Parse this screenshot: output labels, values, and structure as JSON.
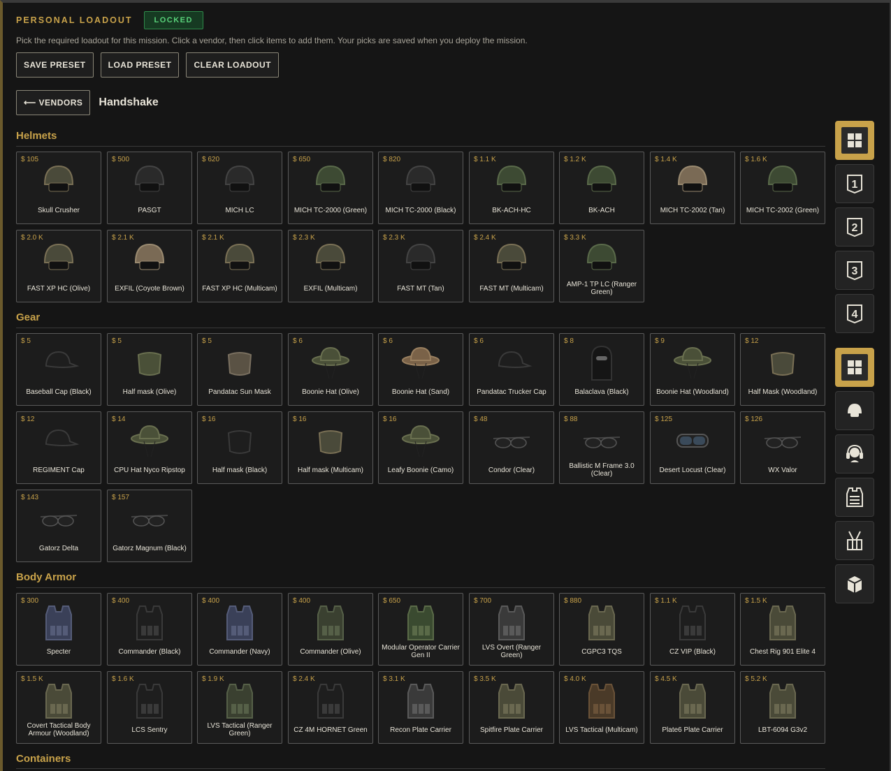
{
  "header": {
    "title": "PERSONAL LOADOUT",
    "status_badge": "LOCKED"
  },
  "description": "Pick the required loadout for this mission. Click a vendor, then click items to add them. Your picks are saved when you deploy the mission.",
  "actions": {
    "save_preset": "SAVE PRESET",
    "load_preset": "LOAD PRESET",
    "clear_loadout": "CLEAR LOADOUT"
  },
  "vendor_nav": {
    "back_label": "⟵ VENDORS",
    "vendor_name": "Handshake"
  },
  "sections": [
    {
      "title": "Helmets",
      "items": [
        {
          "price": "$ 105",
          "name": "Skull Crusher",
          "kind": "helmet-camo"
        },
        {
          "price": "$ 500",
          "name": "PASGT",
          "kind": "helmet-black"
        },
        {
          "price": "$ 620",
          "name": "MICH LC",
          "kind": "helmet-black"
        },
        {
          "price": "$ 650",
          "name": "MICH TC-2000 (Green)",
          "kind": "helmet-green"
        },
        {
          "price": "$ 820",
          "name": "MICH TC-2000 (Black)",
          "kind": "helmet-black"
        },
        {
          "price": "$ 1.1 K",
          "name": "BK-ACH-HC",
          "kind": "helmet-green"
        },
        {
          "price": "$ 1.2 K",
          "name": "BK-ACH",
          "kind": "helmet-green"
        },
        {
          "price": "$ 1.4 K",
          "name": "MICH TC-2002 (Tan)",
          "kind": "helmet-tan"
        },
        {
          "price": "$ 1.6 K",
          "name": "MICH TC-2002 (Green)",
          "kind": "helmet-green"
        },
        {
          "price": "$ 2.0 K",
          "name": "FAST XP HC (Olive)",
          "kind": "helmet-camo"
        },
        {
          "price": "$ 2.1 K",
          "name": "EXFIL (Coyote Brown)",
          "kind": "helmet-tan"
        },
        {
          "price": "$ 2.1 K",
          "name": "FAST XP HC (Multicam)",
          "kind": "helmet-camo"
        },
        {
          "price": "$ 2.3 K",
          "name": "EXFIL (Multicam)",
          "kind": "helmet-camo"
        },
        {
          "price": "$ 2.3 K",
          "name": "FAST MT (Tan)",
          "kind": "helmet-black"
        },
        {
          "price": "$ 2.4 K",
          "name": "FAST MT (Multicam)",
          "kind": "helmet-camo"
        },
        {
          "price": "$ 3.3 K",
          "name": "AMP-1 TP LC (Ranger Green)",
          "kind": "helmet-green"
        }
      ]
    },
    {
      "title": "Gear",
      "items": [
        {
          "price": "$ 5",
          "name": "Baseball Cap (Black)",
          "kind": "cap-black"
        },
        {
          "price": "$ 5",
          "name": "Half mask (Olive)",
          "kind": "mask-olive"
        },
        {
          "price": "$ 5",
          "name": "Pandatac Sun Mask",
          "kind": "mask-tan"
        },
        {
          "price": "$ 6",
          "name": "Boonie Hat (Olive)",
          "kind": "boonie-olive"
        },
        {
          "price": "$ 6",
          "name": "Boonie Hat (Sand)",
          "kind": "boonie-sand"
        },
        {
          "price": "$ 6",
          "name": "Pandatac Trucker Cap",
          "kind": "cap-black"
        },
        {
          "price": "$ 8",
          "name": "Balaclava (Black)",
          "kind": "balaclava"
        },
        {
          "price": "$ 9",
          "name": "Boonie Hat (Woodland)",
          "kind": "boonie-olive"
        },
        {
          "price": "$ 12",
          "name": "Half Mask (Woodland)",
          "kind": "mask-camo"
        },
        {
          "price": "$ 12",
          "name": "REGIMENT Cap",
          "kind": "cap-black"
        },
        {
          "price": "$ 14",
          "name": "CPU Hat Nyco Ripstop",
          "kind": "boonie-olive"
        },
        {
          "price": "$ 16",
          "name": "Half mask (Black)",
          "kind": "mask-black"
        },
        {
          "price": "$ 16",
          "name": "Half mask (Multicam)",
          "kind": "mask-camo"
        },
        {
          "price": "$ 16",
          "name": "Leafy Boonie (Camo)",
          "kind": "boonie-olive"
        },
        {
          "price": "$ 48",
          "name": "Condor (Clear)",
          "kind": "glasses"
        },
        {
          "price": "$ 88",
          "name": "Ballistic M Frame 3.0 (Clear)",
          "kind": "glasses"
        },
        {
          "price": "$ 125",
          "name": "Desert Locust (Clear)",
          "kind": "goggles"
        },
        {
          "price": "$ 126",
          "name": "WX Valor",
          "kind": "glasses"
        },
        {
          "price": "$ 143",
          "name": "Gatorz Delta",
          "kind": "glasses"
        },
        {
          "price": "$ 157",
          "name": "Gatorz Magnum (Black)",
          "kind": "glasses-wide"
        }
      ]
    },
    {
      "title": "Body Armor",
      "items": [
        {
          "price": "$ 300",
          "name": "Specter",
          "kind": "vest-navy"
        },
        {
          "price": "$ 400",
          "name": "Commander (Black)",
          "kind": "vest-black"
        },
        {
          "price": "$ 400",
          "name": "Commander (Navy)",
          "kind": "vest-navy"
        },
        {
          "price": "$ 400",
          "name": "Commander (Olive)",
          "kind": "vest-olive"
        },
        {
          "price": "$ 650",
          "name": "Modular Operator Carrier Gen II",
          "kind": "vest-green"
        },
        {
          "price": "$ 700",
          "name": "LVS Overt (Ranger Green)",
          "kind": "vest-grey"
        },
        {
          "price": "$ 880",
          "name": "CGPC3 TQS",
          "kind": "vest-camo"
        },
        {
          "price": "$ 1.1 K",
          "name": "CZ VIP (Black)",
          "kind": "vest-black"
        },
        {
          "price": "$ 1.5 K",
          "name": "Chest Rig 901 Elite 4",
          "kind": "vest-camo"
        },
        {
          "price": "$ 1.5 K",
          "name": "Covert Tactical Body Armour (Woodland)",
          "kind": "vest-camo"
        },
        {
          "price": "$ 1.6 K",
          "name": "LCS Sentry",
          "kind": "vest-black"
        },
        {
          "price": "$ 1.9 K",
          "name": "LVS Tactical (Ranger Green)",
          "kind": "vest-olive"
        },
        {
          "price": "$ 2.4 K",
          "name": "CZ 4M HORNET Green",
          "kind": "vest-black"
        },
        {
          "price": "$ 3.1 K",
          "name": "Recon Plate Carrier",
          "kind": "vest-grey"
        },
        {
          "price": "$ 3.5 K",
          "name": "Spitfire Plate Carrier",
          "kind": "vest-camo"
        },
        {
          "price": "$ 4.0 K",
          "name": "LVS Tactical (Multicam)",
          "kind": "vest-brown"
        },
        {
          "price": "$ 4.5 K",
          "name": "Plate6 Plate Carrier",
          "kind": "vest-camo"
        },
        {
          "price": "$ 5.2 K",
          "name": "LBT-6094 G3v2",
          "kind": "vest-camo"
        }
      ]
    },
    {
      "title": "Containers",
      "items": []
    }
  ],
  "sidebar": {
    "group_a": [
      {
        "icon": "grid-icon",
        "active": true
      },
      {
        "icon": "slot-1-icon",
        "label": "1"
      },
      {
        "icon": "slot-2-icon",
        "label": "2"
      },
      {
        "icon": "slot-3-icon",
        "label": "3"
      },
      {
        "icon": "slot-4-icon",
        "label": "4"
      }
    ],
    "group_b": [
      {
        "icon": "grid-icon",
        "active": true
      },
      {
        "icon": "helmet-icon"
      },
      {
        "icon": "headset-icon"
      },
      {
        "icon": "body-armor-icon"
      },
      {
        "icon": "chest-rig-icon"
      },
      {
        "icon": "container-box-icon"
      }
    ]
  },
  "colors": {
    "accent": "#c8a24a",
    "locked_text": "#59d27a",
    "locked_bg": "#163a22",
    "background": "#151515",
    "card": "#1c1c1c"
  }
}
